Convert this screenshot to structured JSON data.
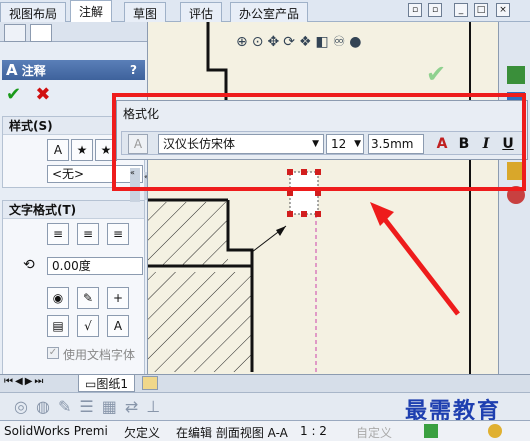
{
  "tabs": [
    "视图布局",
    "注解",
    "草图",
    "评估",
    "办公室产品"
  ],
  "active_tab": 1,
  "panel": {
    "title": "注释",
    "help": "?",
    "style_section": "样式(S)",
    "style_value": "<无>",
    "text_format_section": "文字格式(T)",
    "angle_value": "0.00度",
    "use_doc_font": "使用文档字体"
  },
  "format_toolbar": {
    "title": "格式化",
    "font": "汉仪长仿宋体",
    "size": "12",
    "height": "3.5mm",
    "bold": "B",
    "italic": "I",
    "underline": "U"
  },
  "sheet_tab": "图纸1",
  "status": {
    "app": "SolidWorks Premi",
    "state": "欠定义",
    "editing": "在编辑 剖面视图 A-A",
    "scale": "1 : 2",
    "custom": "自定义"
  },
  "watermark": "最需教育",
  "colors": {
    "highlight": "#ee1c1c",
    "panel_title": "#3e629c",
    "ok": "#1a9a1a",
    "cancel": "#d01010"
  }
}
